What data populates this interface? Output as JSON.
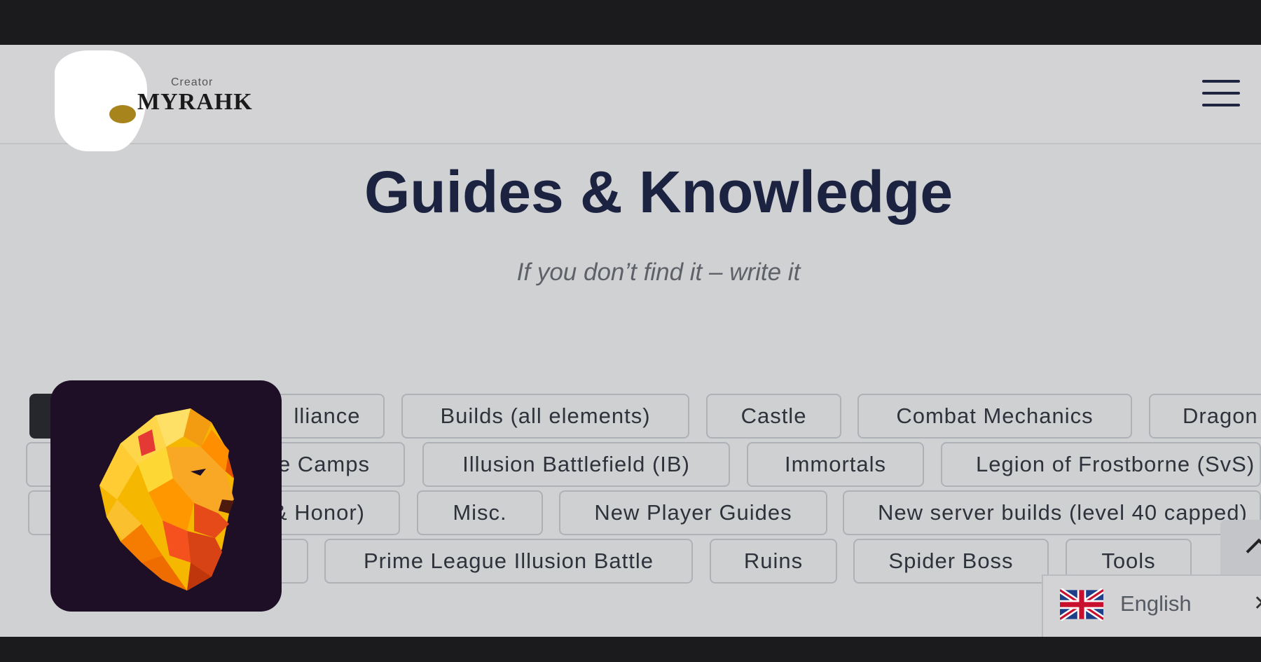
{
  "header": {
    "logo_creator": "Creator",
    "logo_name": "MYRAHK"
  },
  "hero": {
    "title": "Guides & Knowledge",
    "subtitle": "If you don’t find it – write it"
  },
  "categories": {
    "row1": [
      "lliance",
      "Builds (all elements)",
      "Castle",
      "Combat Mechanics",
      "Dragon"
    ],
    "row2": [
      "e Camps",
      "Illusion Battlefield (IB)",
      "Immortals",
      "Legion of Frostborne (SvS)"
    ],
    "row3": [
      "& Honor)",
      "Misc.",
      "New Player Guides",
      "New server builds (level 40 capped)"
    ],
    "row4": [
      "Prime League Illusion Battle",
      "Ruins",
      "Spider Boss",
      "Tools"
    ]
  },
  "language": {
    "label": "English",
    "close": "✕",
    "flag_icon": "uk-flag-icon"
  },
  "icons": {
    "menu": "hamburger-menu-icon",
    "scroll_top": "chevron-up-icon",
    "app": "lion-app-icon"
  },
  "colors": {
    "title": "#1c2340",
    "app_icon_bg": "#1e0f26",
    "active_pill": "#25272d"
  }
}
